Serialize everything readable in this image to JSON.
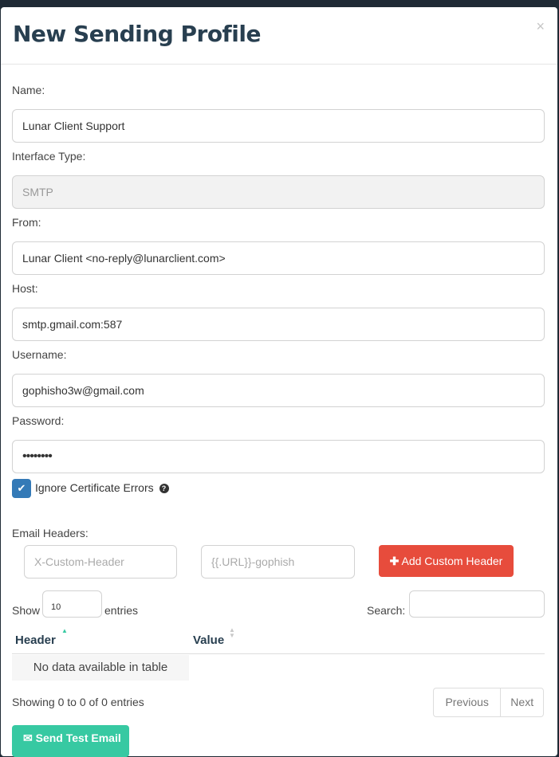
{
  "modal": {
    "title": "New Sending Profile",
    "close": "×"
  },
  "form": {
    "name_label": "Name:",
    "name_value": "Lunar Client Support",
    "interface_label": "Interface Type:",
    "interface_value": "SMTP",
    "from_label": "From:",
    "from_value": "Lunar Client <no-reply@lunarclient.com>",
    "host_label": "Host:",
    "host_value": "smtp.gmail.com:587",
    "username_label": "Username:",
    "username_value": "gophisho3w@gmail.com",
    "password_label": "Password:",
    "password_value": "••••••••",
    "ignore_cert_label": "Ignore Certificate Errors",
    "ignore_cert_checked": true,
    "help_icon": "question-circle-icon"
  },
  "headers": {
    "label": "Email Headers:",
    "header_placeholder": "X-Custom-Header",
    "value_placeholder": "{{.URL}}-gophish",
    "add_button": "Add Custom Header",
    "add_color": "#e74c3c"
  },
  "table": {
    "show_label": "Show",
    "entries_value": "10",
    "entries_label": "entries",
    "search_label": "Search:",
    "columns": [
      "Header",
      "Value"
    ],
    "empty_text": "No data available in table",
    "info": "Showing 0 to 0 of 0 entries",
    "prev": "Previous",
    "next": "Next"
  },
  "footer": {
    "send_test": "Send Test Email",
    "accent": "#37c9a2"
  }
}
